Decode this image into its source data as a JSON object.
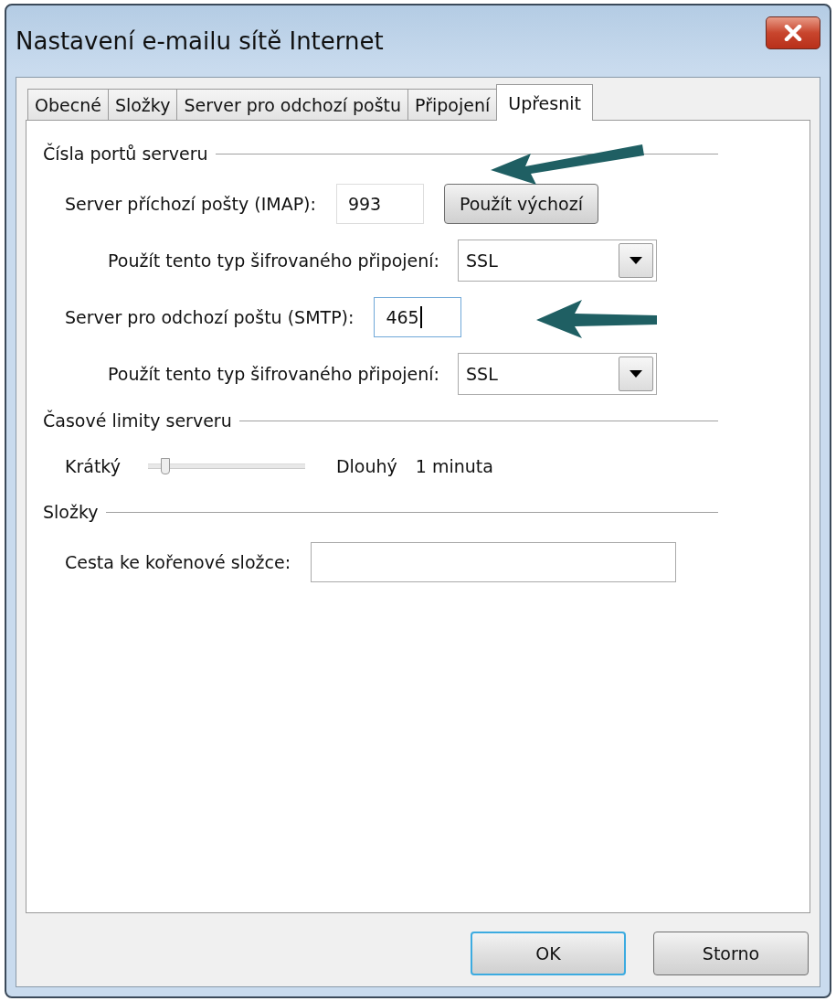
{
  "window": {
    "title": "Nastavení e-mailu sítě Internet"
  },
  "tabs": [
    {
      "label": "Obecné",
      "selected": false
    },
    {
      "label": "Složky",
      "selected": false
    },
    {
      "label": "Server pro odchozí poštu",
      "selected": false
    },
    {
      "label": "Připojení",
      "selected": false
    },
    {
      "label": "Upřesnit",
      "selected": true
    }
  ],
  "sections": [
    {
      "title": "Čísla portů serveru",
      "rows": [
        {
          "kind": "port",
          "label": "Server příchozí pošty (IMAP):",
          "value": "993",
          "focused": false,
          "button": "Použít výchozí"
        },
        {
          "kind": "select",
          "label": "Použít tento typ šifrovaného připojení:",
          "value": "SSL"
        },
        {
          "kind": "port",
          "label": "Server pro odchozí poštu (SMTP):",
          "value": "465",
          "focused": true
        },
        {
          "kind": "select",
          "label": "Použít tento typ šifrovaného připojení:",
          "value": "SSL"
        }
      ]
    },
    {
      "title": "Časové limity serveru",
      "rows": [
        {
          "kind": "slider",
          "label_min": "Krátký",
          "label_max": "Dlouhý",
          "reading": "1 minuta",
          "level": 0.08
        }
      ]
    },
    {
      "title": "Složky",
      "rows": [
        {
          "kind": "path",
          "label": "Cesta ke kořenové složce:"
        }
      ]
    }
  ],
  "buttons": [
    {
      "label": "OK",
      "default": true
    },
    {
      "label": "Storno",
      "default": false
    }
  ]
}
